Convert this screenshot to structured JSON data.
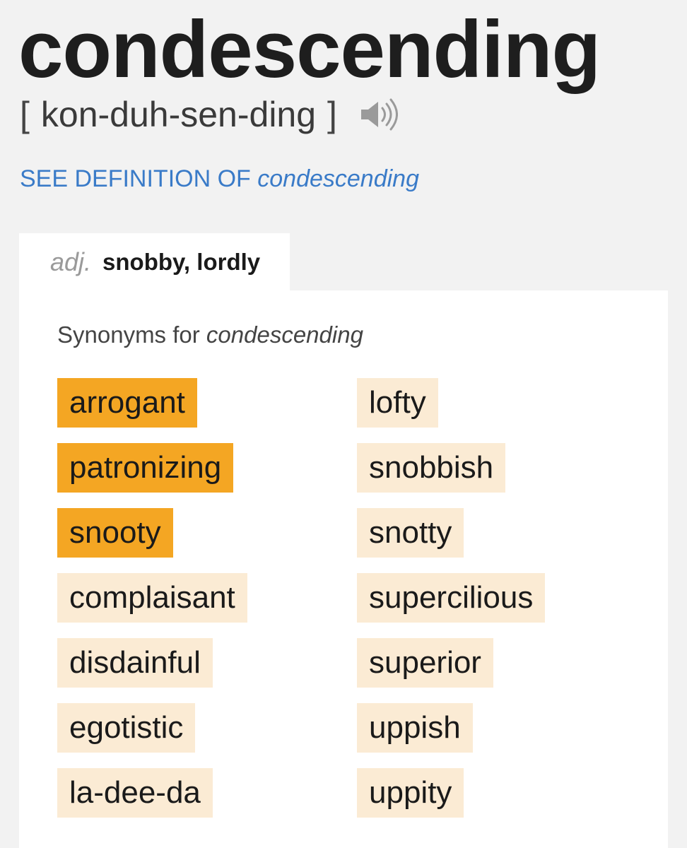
{
  "entry": {
    "word": "condescending",
    "pronunciation": "kon-duh-sen-ding",
    "bracket_open": "[",
    "bracket_close": "]",
    "audio_icon": "speaker-icon",
    "see_definition_prefix": "SEE DEFINITION OF",
    "see_definition_word": "condescending"
  },
  "tab": {
    "pos": "adj.",
    "sense": "snobby, lordly"
  },
  "synonyms": {
    "heading_prefix": "Synonyms for",
    "heading_word": "condescending",
    "colors": {
      "strong": "#f4a623",
      "weak": "#fbebd4"
    },
    "left_column": [
      {
        "text": "arrogant",
        "relevance": "strong"
      },
      {
        "text": "patronizing",
        "relevance": "strong"
      },
      {
        "text": "snooty",
        "relevance": "strong"
      },
      {
        "text": "complaisant",
        "relevance": "weak"
      },
      {
        "text": "disdainful",
        "relevance": "weak"
      },
      {
        "text": "egotistic",
        "relevance": "weak"
      },
      {
        "text": "la-dee-da",
        "relevance": "weak"
      }
    ],
    "right_column": [
      {
        "text": "lofty",
        "relevance": "weak"
      },
      {
        "text": "snobbish",
        "relevance": "weak"
      },
      {
        "text": "snotty",
        "relevance": "weak"
      },
      {
        "text": "supercilious",
        "relevance": "weak"
      },
      {
        "text": "superior",
        "relevance": "weak"
      },
      {
        "text": "uppish",
        "relevance": "weak"
      },
      {
        "text": "uppity",
        "relevance": "weak"
      }
    ]
  }
}
